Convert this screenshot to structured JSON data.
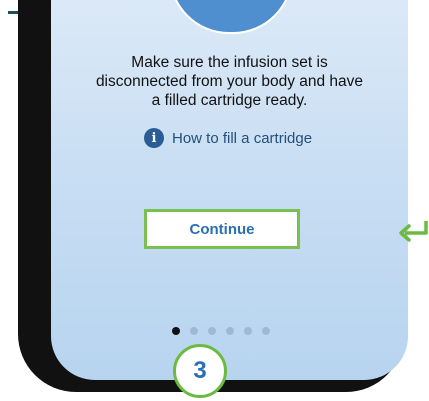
{
  "screen": {
    "instruction": "Make sure the infusion set is disconnected from your body and have a filled cartridge ready.",
    "instruction_lines": [
      "Make sure the infusion set is",
      "disconnected from your body and have",
      "a filled cartridge ready."
    ],
    "help_link": {
      "icon": "info-icon",
      "label": "How to fill a cartridge"
    },
    "continue_label": "Continue",
    "pager": {
      "total": 6,
      "active": 1
    }
  },
  "step_badge": "3",
  "colors": {
    "highlight_green": "#6dba43",
    "accent_blue": "#2a6fb5",
    "info_blue": "#2a5d96"
  }
}
